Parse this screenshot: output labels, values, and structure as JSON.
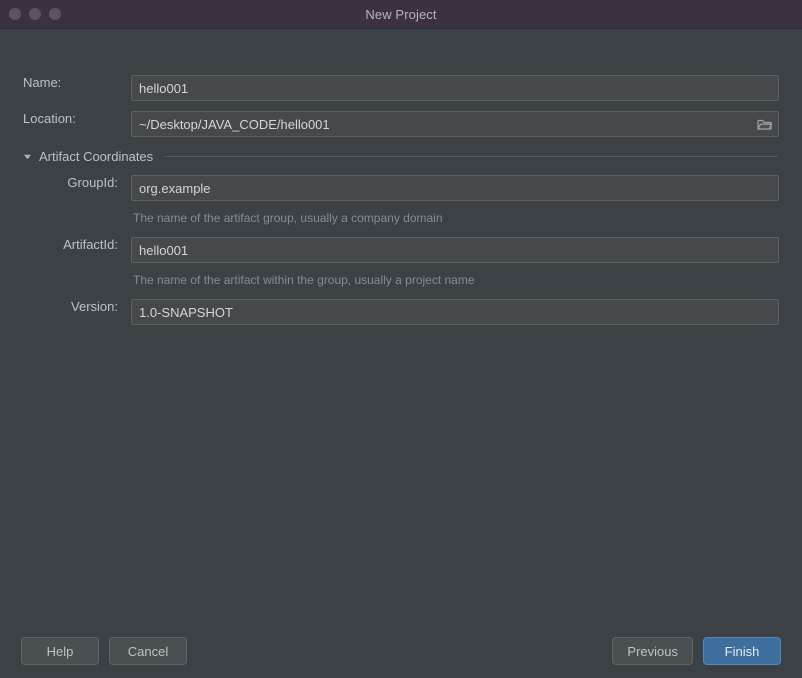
{
  "window": {
    "title": "New Project",
    "traffic_lights": [
      "close",
      "minimize",
      "maximize"
    ]
  },
  "form": {
    "name": {
      "label": "Name:",
      "value": "hello001",
      "placeholder": ""
    },
    "location": {
      "label": "Location:",
      "value": "~/Desktop/JAVA_CODE/hello001",
      "placeholder": "",
      "browse_icon": "folder-icon"
    },
    "section": {
      "title": "Artifact Coordinates",
      "expanded": true,
      "twisty_icon": "chevron-down-icon"
    },
    "group_id": {
      "label": "GroupId:",
      "value": "org.example",
      "placeholder": "",
      "hint": "The name of the artifact group, usually a company domain"
    },
    "artifact_id": {
      "label": "ArtifactId:",
      "value": "hello001",
      "placeholder": "",
      "hint": "The name of the artifact within the group, usually a project name"
    },
    "version": {
      "label": "Version:",
      "value": "1.0-SNAPSHOT",
      "placeholder": ""
    }
  },
  "footer": {
    "help_label": "Help",
    "cancel_label": "Cancel",
    "previous_label": "Previous",
    "finish_label": "Finish"
  },
  "colors": {
    "dialog_bg": "#3c4145",
    "titlebar_bg": "#3b3240",
    "input_bg": "#45494a",
    "input_border": "#5c6164",
    "text": "#bfc2c4",
    "hint_text": "#898c8e",
    "primary_button": "#3d6e9e",
    "traffic_light": "#5c5263"
  }
}
